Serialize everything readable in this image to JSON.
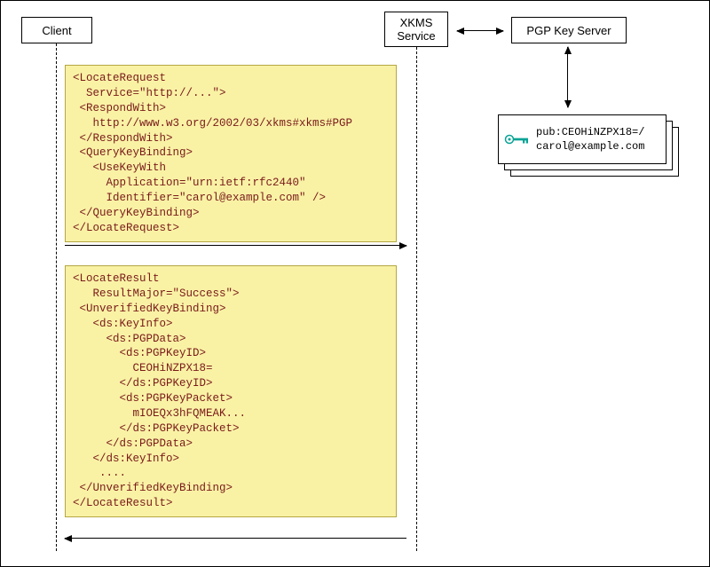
{
  "actors": {
    "client": "Client",
    "xkms": "XKMS\nService",
    "pgp": "PGP Key Server"
  },
  "request": "<LocateRequest\n  Service=\"http://...\">\n <RespondWith>\n   http://www.w3.org/2002/03/xkms#xkms#PGP\n </RespondWith>\n <QueryKeyBinding>\n   <UseKeyWith\n     Application=\"urn:ietf:rfc2440\"\n     Identifier=\"carol@example.com\" />\n </QueryKeyBinding>\n</LocateRequest>",
  "response": "<LocateResult\n   ResultMajor=\"Success\">\n <UnverifiedKeyBinding>\n   <ds:KeyInfo>\n     <ds:PGPData>\n       <ds:PGPKeyID>\n         CEOHiNZPX18=\n       </ds:PGPKeyID>\n       <ds:PGPKeyPacket>\n         mIOEQx3hFQMEAK...\n       </ds:PGPKeyPacket>\n     </ds:PGPData>\n   </ds:KeyInfo>\n    ....\n </UnverifiedKeyBinding>\n</LocateResult>",
  "key_card": {
    "line1": "pub:CEOHiNZPX18=/",
    "line2": "carol@example.com"
  }
}
